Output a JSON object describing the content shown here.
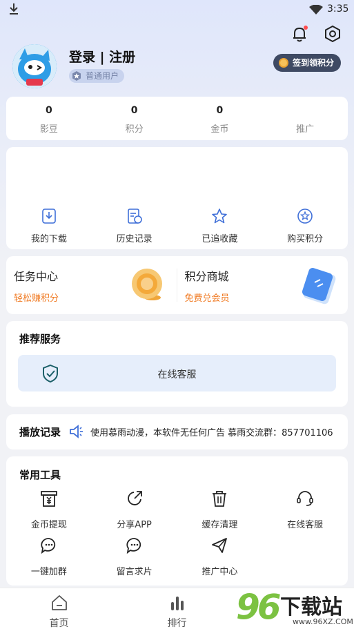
{
  "status_bar": {
    "time": "3:35",
    "icons": [
      "download-icon",
      "wifi-icon"
    ]
  },
  "header": {
    "icons": [
      "bell-icon",
      "settings-icon"
    ],
    "bell_has_dot": true
  },
  "profile": {
    "login_label": "登录 | 注册",
    "user_type": "普通用户",
    "signin_button": "签到领积分"
  },
  "stats": [
    {
      "value": "0",
      "label": "影豆"
    },
    {
      "value": "0",
      "label": "积分"
    },
    {
      "value": "0",
      "label": "金币"
    },
    {
      "value": "",
      "label": "推广"
    }
  ],
  "quick_actions": [
    {
      "label": "我的下载",
      "icon": "download-box-icon"
    },
    {
      "label": "历史记录",
      "icon": "history-icon"
    },
    {
      "label": "已追收藏",
      "icon": "star-icon"
    },
    {
      "label": "购买积分",
      "icon": "star-circle-icon"
    }
  ],
  "promo": [
    {
      "title": "任务中心",
      "subtitle": "轻松赚积分",
      "icon": "gold-coin-icon"
    },
    {
      "title": "积分商城",
      "subtitle": "免费兑会员",
      "icon": "voucher-icon"
    }
  ],
  "recommend": {
    "title": "推荐服务",
    "service_label": "在线客服",
    "service_icon": "shield-check-icon"
  },
  "history": {
    "title": "播放记录",
    "notice": "使用慕雨动漫，本软件无任何广告 慕雨交流群：857701106"
  },
  "tools": {
    "title": "常用工具",
    "items": [
      {
        "label": "金币提现",
        "icon": "withdraw-icon"
      },
      {
        "label": "分享APP",
        "icon": "share-icon"
      },
      {
        "label": "缓存清理",
        "icon": "trash-icon"
      },
      {
        "label": "在线客服",
        "icon": "headset-icon"
      },
      {
        "label": "一键加群",
        "icon": "chat-group-icon"
      },
      {
        "label": "留言求片",
        "icon": "message-icon"
      },
      {
        "label": "推广中心",
        "icon": "send-icon"
      }
    ]
  },
  "bottom_nav": [
    {
      "label": "首页",
      "icon": "home-icon"
    },
    {
      "label": "排行",
      "icon": "rank-icon"
    },
    {
      "label": "",
      "icon": ""
    }
  ],
  "watermark": {
    "number": "96",
    "text": "下载站",
    "url": "www.96XZ.COM"
  },
  "colors": {
    "accent": "#3f6fd8",
    "orange": "#f07b24",
    "service_bg": "#e6eefb",
    "signin_bg": "#3f4a63"
  }
}
